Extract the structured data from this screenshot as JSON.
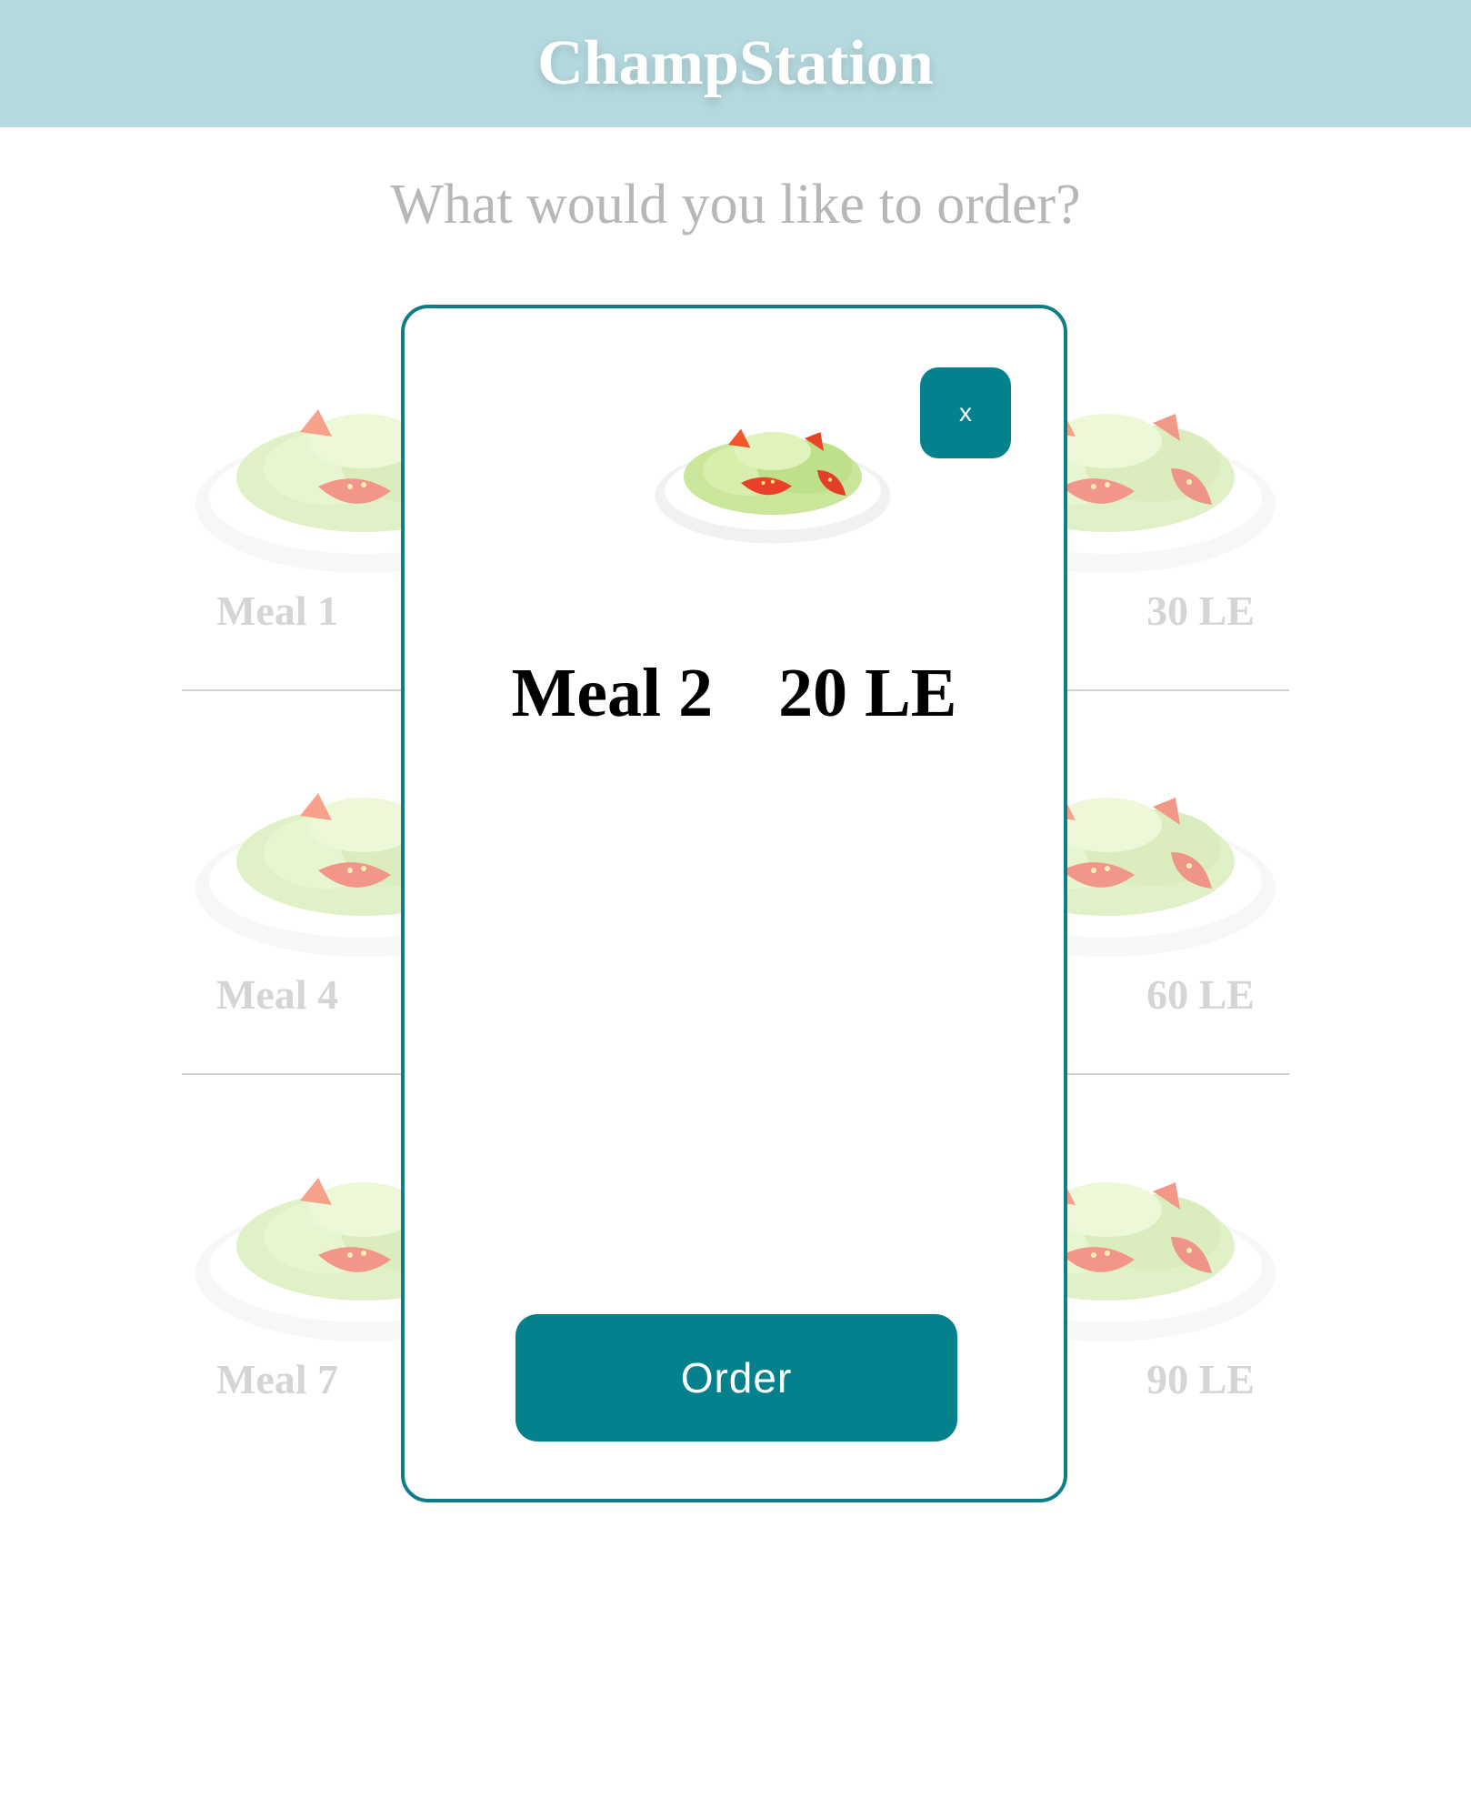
{
  "header": {
    "title": "ChampStation"
  },
  "prompt": "What would you like to order?",
  "meals": [
    {
      "label": "Meal 1",
      "price": ""
    },
    {
      "label": "",
      "price": "30 LE"
    },
    {
      "label": "Meal 4",
      "price": ""
    },
    {
      "label": "",
      "price": "60 LE"
    },
    {
      "label": "Meal 7",
      "price": ""
    },
    {
      "label": "",
      "price": "90 LE"
    }
  ],
  "modal": {
    "close_label": "x",
    "meal_name": "Meal 2",
    "meal_price": "20 LE",
    "order_label": "Order"
  },
  "colors": {
    "header_bg": "#b4d9de",
    "accent": "#05818e",
    "muted_text": "#b3b3b3"
  }
}
